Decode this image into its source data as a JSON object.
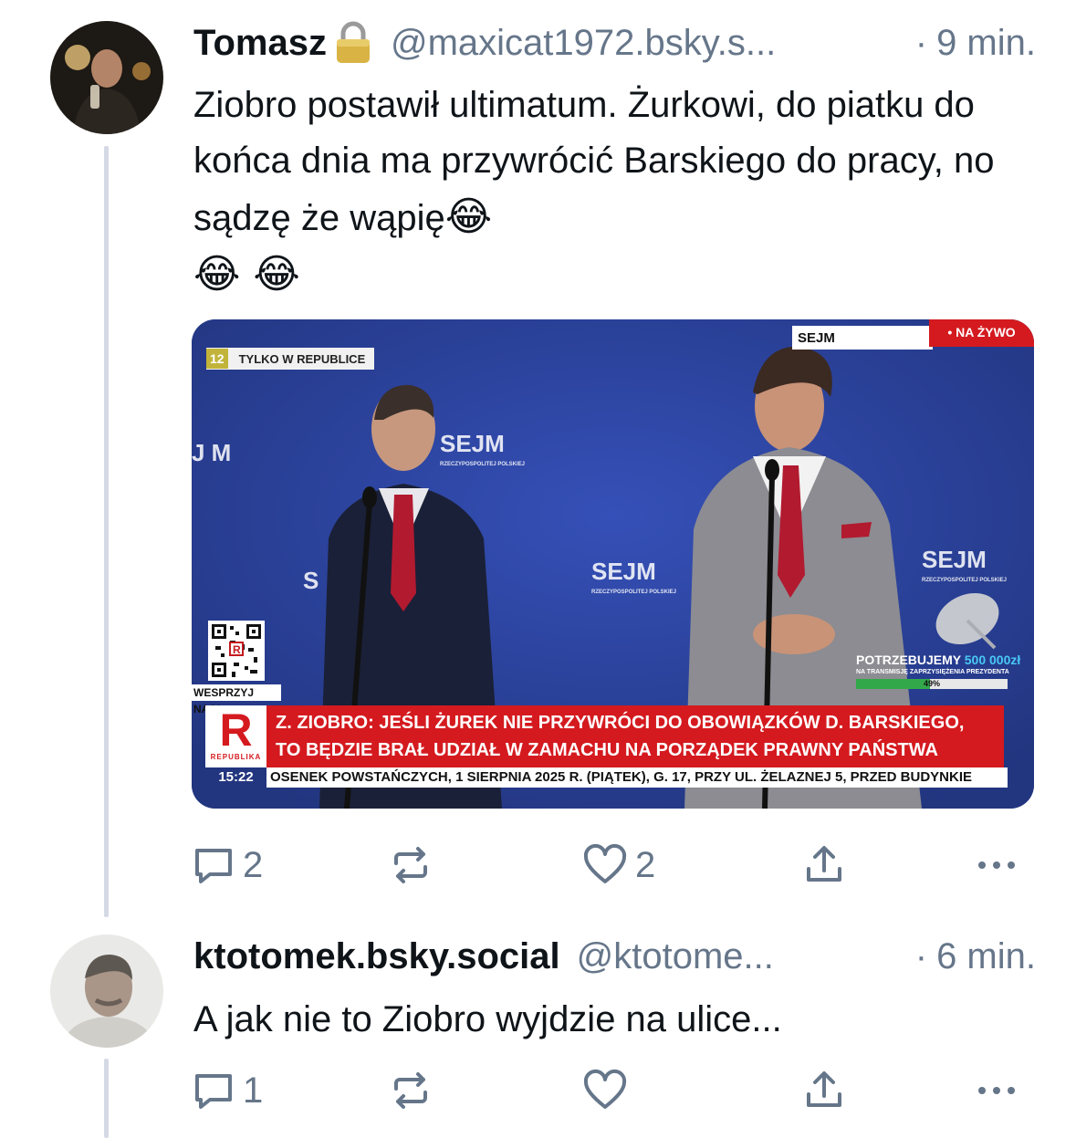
{
  "posts": [
    {
      "author_name": "Tomasz",
      "author_badge_icon": "lock-emoji",
      "handle": "@maxicat1972.bsky.s...",
      "separator": "·",
      "time": "9 min.",
      "text": "Ziobro postawił ultimatum. Żurkowi, do piatku do końca dnia ma przywrócić Barskiego do pracy, no sądzę że wąpię",
      "text_emoji": "😂",
      "text_line4_emoji": "😂 😂",
      "actions": {
        "reply_count": "2",
        "repost_count": "",
        "like_count": "2"
      }
    },
    {
      "author_name": "ktotomek.bsky.social",
      "handle": "@ktotome...",
      "separator": "·",
      "time": "6 min.",
      "text": "A jak nie to Ziobro wyjdzie na ulice...",
      "actions": {
        "reply_count": "1",
        "repost_count": "",
        "like_count": ""
      }
    }
  ],
  "embed": {
    "channel_number": "12",
    "exclusive_label": "TYLKO W REPUBLICE",
    "location_label": "SEJM",
    "live_label": "• NA ŻYWO",
    "backdrop_logo": "SEJM",
    "backdrop_subtitle": "RZECZYPOSPOLITEJ POLSKIEJ",
    "qr_caption": "WESPRZYJ NAS!",
    "donation_headline": "POTRZEBUJEMY",
    "donation_amount": "500 000zł",
    "donation_sub": "NA TRANSMISJĘ ZAPRZYSIĘŻENIA PREZYDENTA",
    "donation_progress_label": "49%",
    "donation_progress": 0.49,
    "headline_line1": "Z. ZIOBRO: JEŚLI ŻUREK NIE PRZYWRÓCI DO OBOWIĄZKÓW D. BARSKIEGO,",
    "headline_line2": "TO BĘDZIE BRAŁ UDZIAŁ W ZAMACHU NA PORZĄDEK PRAWNY PAŃSTWA",
    "channel_logo_letter": "R",
    "channel_name": "REPUBLIKA",
    "clock": "15:22",
    "ticker": "OSENEK POWSTAŃCZYCH, 1 SIERPNIA 2025 R. (PIĄTEK), G. 17, PRZY UL. ŻELAZNEJ 5, PRZED BUDYNKIE"
  },
  "colors": {
    "text": "#0f1419",
    "muted": "#66768a",
    "thread_line": "#d4d9e4",
    "tv_red": "#d41a1f",
    "tv_blue": "#2b3f9a"
  }
}
